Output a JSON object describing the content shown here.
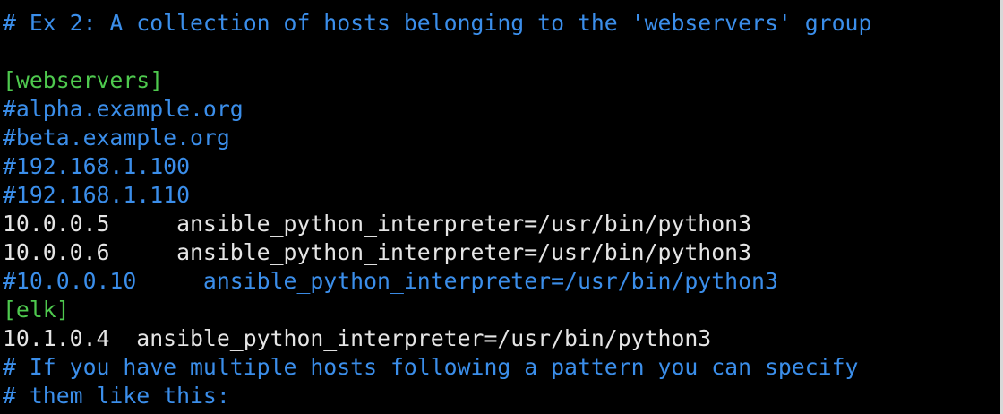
{
  "colors": {
    "background": "#000000",
    "comment": "#3b8eea",
    "section": "#4ec94e",
    "text": "#e5e5e5"
  },
  "lines": [
    {
      "kind": "comment",
      "text": "# Ex 2: A collection of hosts belonging to the 'webservers' group"
    },
    {
      "kind": "blank",
      "text": ""
    },
    {
      "kind": "section",
      "text": "[webservers]"
    },
    {
      "kind": "comment",
      "text": "#alpha.example.org"
    },
    {
      "kind": "comment",
      "text": "#beta.example.org"
    },
    {
      "kind": "comment",
      "text": "#192.168.1.100"
    },
    {
      "kind": "comment",
      "text": "#192.168.1.110"
    },
    {
      "kind": "text",
      "text": "10.0.0.5     ansible_python_interpreter=/usr/bin/python3"
    },
    {
      "kind": "text",
      "text": "10.0.0.6     ansible_python_interpreter=/usr/bin/python3"
    },
    {
      "kind": "comment",
      "text": "#10.0.0.10     ansible_python_interpreter=/usr/bin/python3"
    },
    {
      "kind": "section",
      "text": "[elk]"
    },
    {
      "kind": "text",
      "text": "10.1.0.4  ansible_python_interpreter=/usr/bin/python3"
    },
    {
      "kind": "comment",
      "text": "# If you have multiple hosts following a pattern you can specify"
    },
    {
      "kind": "comment",
      "text": "# them like this:"
    }
  ]
}
